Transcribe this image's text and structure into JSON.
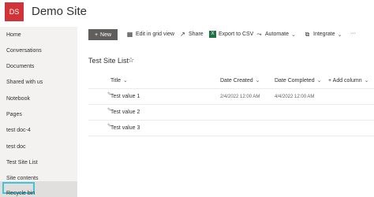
{
  "site": {
    "logo": "DS",
    "title": "Demo Site"
  },
  "nav": {
    "items": [
      "Home",
      "Conversations",
      "Documents",
      "Shared with us",
      "Notebook",
      "Pages",
      "test doc-4",
      "test doc",
      "Test Site List",
      "Site contents",
      "Recycle bin"
    ],
    "selected": "Test Site List"
  },
  "toolbar": {
    "new_label": "New",
    "grid_label": "Edit in grid view",
    "share_label": "Share",
    "export_label": "Export to CSV",
    "automate_label": "Automate",
    "integrate_label": "Integrate",
    "more_label": "···"
  },
  "list": {
    "title": "Test Site List",
    "columns": {
      "title": "Title",
      "created": "Date Created",
      "completed": "Date Completed",
      "add": "+ Add column"
    },
    "rows": [
      {
        "title": "Test value 1",
        "created": "2/4/2022 12:00 AM",
        "completed": "4/4/2022 12:00 AM"
      },
      {
        "title": "Test value 2",
        "created": "",
        "completed": ""
      },
      {
        "title": "Test value 3",
        "created": "",
        "completed": ""
      }
    ]
  }
}
